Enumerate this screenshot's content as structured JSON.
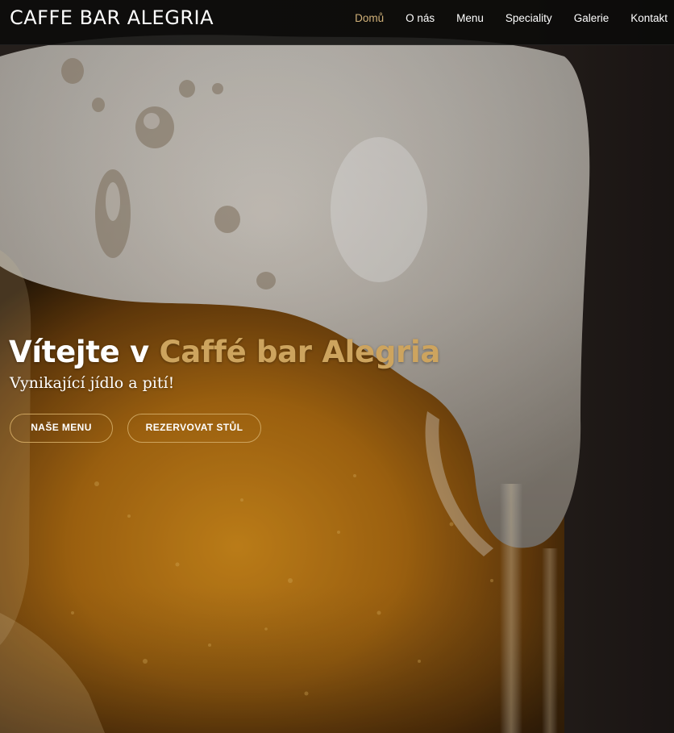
{
  "brand": {
    "logo_text": "CAFFE BAR ALEGRIA",
    "accent_color": "#cda45e",
    "active_nav_color": "#d1b179"
  },
  "nav": {
    "items": [
      {
        "label": "Domů",
        "active": true
      },
      {
        "label": "O nás",
        "active": false
      },
      {
        "label": "Menu",
        "active": false
      },
      {
        "label": "Speciality",
        "active": false
      },
      {
        "label": "Galerie",
        "active": false
      },
      {
        "label": "Kontakt",
        "active": false
      }
    ]
  },
  "hero": {
    "title_prefix": "Vítejte v ",
    "title_accent": "Caffé bar Alegria",
    "subtitle": "Vynikající jídlo a pití!",
    "buttons": {
      "menu_label": "Naše Menu",
      "book_label": "Rezervovat stůl"
    },
    "background_image": "beer-glass-with-foam-photo"
  }
}
